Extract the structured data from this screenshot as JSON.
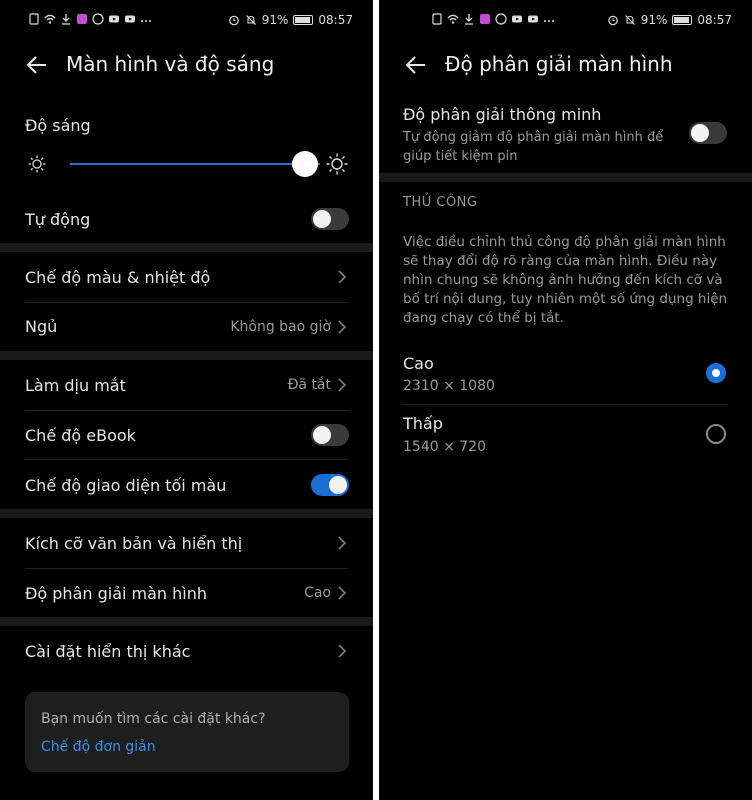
{
  "status": {
    "battery": "91%",
    "time": "08:57"
  },
  "left": {
    "title": "Màn hình và độ sáng",
    "brightness_label": "Độ sáng",
    "brightness_level": 0.94,
    "auto_label": "Tự động",
    "auto_on": false,
    "color_mode_label": "Chế độ màu & nhiệt độ",
    "sleep_label": "Ngủ",
    "sleep_value": "Không bao giờ",
    "eye_comfort_label": "Làm dịu mắt",
    "eye_comfort_value": "Đã tắt",
    "ebook_label": "Chế độ eBook",
    "ebook_on": false,
    "dark_mode_label": "Chế độ giao diện tối màu",
    "dark_mode_on": true,
    "text_size_label": "Kích cỡ văn bản và hiển thị",
    "resolution_label": "Độ phân giải màn hình",
    "resolution_value": "Cao",
    "more_label": "Cài đặt hiển thị khác",
    "card_question": "Bạn muốn tìm các cài đặt khác?",
    "card_link": "Chế độ đơn giản"
  },
  "right": {
    "title": "Độ phân giải màn hình",
    "smart_label": "Độ phân giải thông minh",
    "smart_desc": "Tự động giảm độ phân giải màn hình để giúp tiết kiệm pin",
    "smart_on": false,
    "manual_header": "THỦ CÔNG",
    "manual_desc": "Việc điều chỉnh thủ công độ phân giải màn hình sẽ thay đổi độ rõ ràng của màn hình. Điều này nhìn chung sẽ không ảnh hưởng đến kích cỡ và bố trí nội dung, tuy nhiên một số ứng dụng hiện đang chạy có thể bị tắt.",
    "options": [
      {
        "label": "Cao",
        "value": "2310 × 1080",
        "selected": true
      },
      {
        "label": "Thấp",
        "value": "1540 × 720",
        "selected": false
      }
    ]
  },
  "colors": {
    "accent": "#1a6fd6",
    "link": "#3d8fe8",
    "background": "#000000"
  }
}
